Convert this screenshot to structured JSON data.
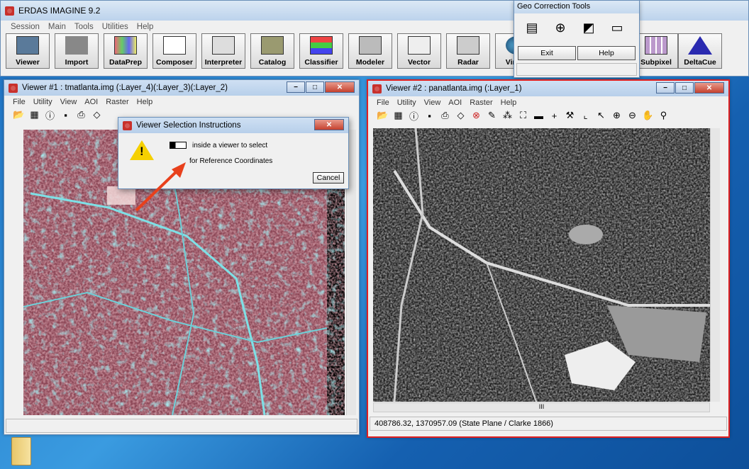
{
  "app": {
    "title": "ERDAS IMAGINE 9.2",
    "menu": [
      "Session",
      "Main",
      "Tools",
      "Utilities",
      "Help"
    ],
    "toolbar": [
      "Viewer",
      "Import",
      "DataPrep",
      "Composer",
      "Interpreter",
      "Catalog",
      "Classifier",
      "Modeler",
      "Vector",
      "Radar",
      "Virtual",
      "Subpixel",
      "DeltaCue"
    ]
  },
  "geo_tools": {
    "title": "Geo Correction Tools",
    "exit": "Exit",
    "help": "Help",
    "icon_names": [
      "display-icon",
      "crosshair-icon",
      "rectify-icon",
      "ruler-icon"
    ]
  },
  "viewer1": {
    "title": "Viewer #1 : tmatlanta.img (:Layer_4)(:Layer_3)(:Layer_2)",
    "menu": [
      "File",
      "Utility",
      "View",
      "AOI",
      "Raster",
      "Help"
    ],
    "image_colors": {
      "base": "#a85866",
      "highlight": "#5fd0d8",
      "urban": "#8fc8cf"
    }
  },
  "viewer2": {
    "title": "Viewer #2 : panatlanta.img (:Layer_1)",
    "menu": [
      "File",
      "Utility",
      "View",
      "AOI",
      "Raster",
      "Help"
    ],
    "status": "408786.32, 1370957.09  (State Plane / Clarke 1866)",
    "scroll_marker": "III",
    "selected_border": "#e02020"
  },
  "dialog": {
    "title": "Viewer Selection Instructions",
    "line1": "inside a viewer to select",
    "line2": "for Reference Coordinates",
    "cancel": "Cancel"
  },
  "window_controls": {
    "min": "−",
    "max": "□",
    "close": "✕"
  }
}
